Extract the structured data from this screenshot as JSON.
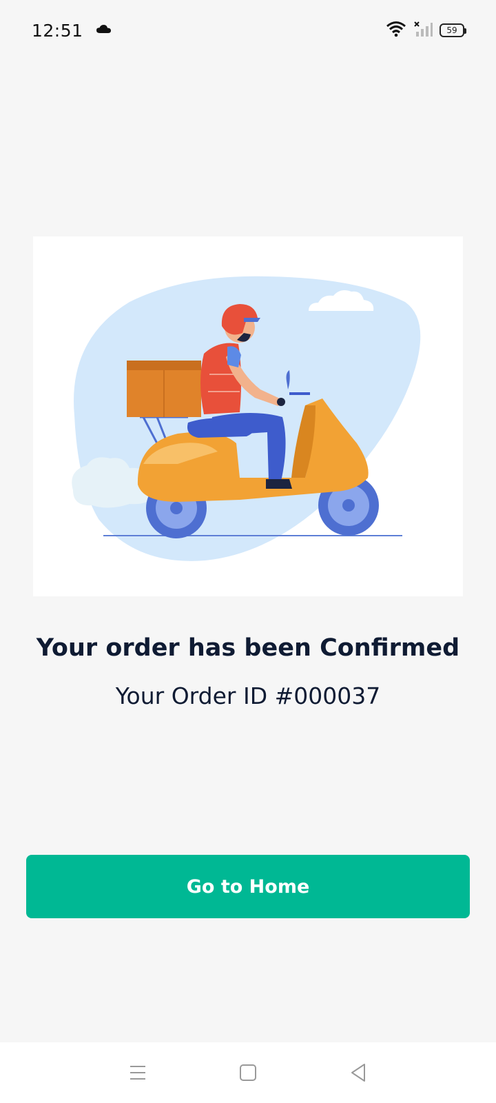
{
  "status_bar": {
    "time": "12:51",
    "battery_level": "59",
    "icons": [
      "cloud-icon",
      "wifi-icon",
      "no-signal-icon",
      "battery-icon"
    ]
  },
  "confirmation": {
    "title": "Your order has been Confirmed",
    "order_id": "Your Order ID #000037"
  },
  "actions": {
    "go_home_label": "Go to Home"
  },
  "nav_bar": {
    "icons": [
      "menu-icon",
      "home-square-icon",
      "back-triangle-icon"
    ]
  },
  "colors": {
    "background": "#f6f6f6",
    "primary_button": "#00b894",
    "text_dark": "#0f1b33"
  }
}
